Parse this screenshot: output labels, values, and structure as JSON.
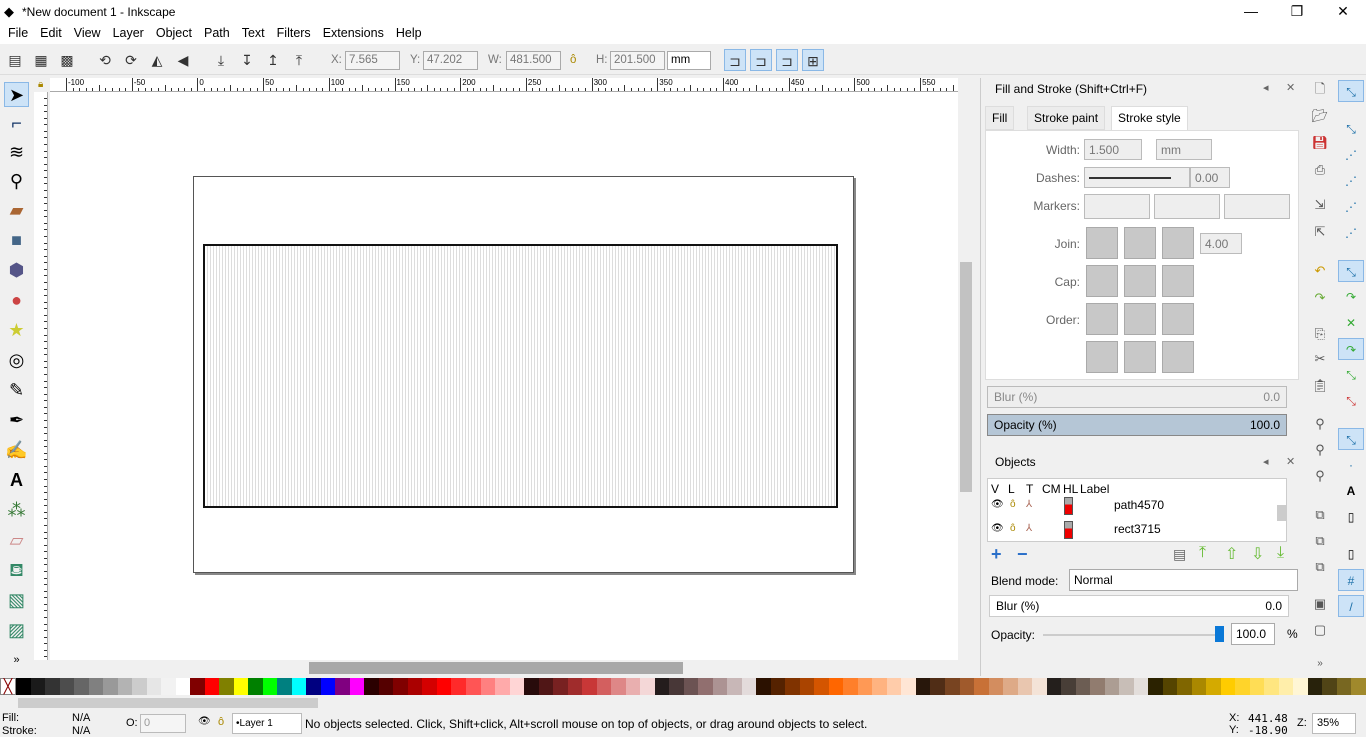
{
  "window": {
    "title": "*New document 1 - Inkscape",
    "minimize": "—",
    "maximize": "❐",
    "close": "✕"
  },
  "menu": [
    "File",
    "Edit",
    "View",
    "Layer",
    "Object",
    "Path",
    "Text",
    "Filters",
    "Extensions",
    "Help"
  ],
  "toolbar": {
    "x_label": "X:",
    "x": "7.565",
    "y_label": "Y:",
    "y": "47.202",
    "w_label": "W:",
    "w": "481.500",
    "h_label": "H:",
    "h": "201.500",
    "unit": "mm"
  },
  "ruler": {
    "h_ticks": [
      "-100",
      "-50",
      "0",
      "50",
      "100",
      "150",
      "200",
      "250",
      "300",
      "350",
      "400",
      "450",
      "500",
      "550"
    ]
  },
  "fill_stroke": {
    "title": "Fill and Stroke (Shift+Ctrl+F)",
    "tabs": [
      "Fill",
      "Stroke paint",
      "Stroke style"
    ],
    "active_tab": "Stroke style",
    "width_label": "Width:",
    "width": "1.500",
    "width_unit": "mm",
    "dashes_label": "Dashes:",
    "dash_offset": "0.00",
    "markers_label": "Markers:",
    "join_label": "Join:",
    "miter": "4.00",
    "cap_label": "Cap:",
    "order_label": "Order:",
    "blur_label": "Blur (%)",
    "blur": "0.0",
    "opacity_label": "Opacity (%)",
    "opacity": "100.0"
  },
  "objects": {
    "title": "Objects",
    "columns": [
      "V",
      "L",
      "T",
      "CM",
      "HL",
      "Label"
    ],
    "rows": [
      {
        "label": "path4570"
      },
      {
        "label": "rect3715"
      }
    ],
    "blend_label": "Blend mode:",
    "blend": "Normal",
    "blur_label": "Blur (%)",
    "blur": "0.0",
    "opacity_label": "Opacity:",
    "opacity": "100.0",
    "opacity_unit": "%",
    "opacity_value": 100
  },
  "status": {
    "fill_label": "Fill:",
    "fill": "N/A",
    "stroke_label": "Stroke:",
    "stroke": "N/A",
    "o_label": "O:",
    "o": "0",
    "layer": "•Layer 1",
    "message": "No objects selected. Click, Shift+click, Alt+scroll mouse on top of objects, or drag around objects to select.",
    "x_label": "X:",
    "cx": "441.48",
    "y_label": "Y:",
    "cy": "-18.90",
    "z_label": "Z:",
    "zoom": "35%"
  },
  "palette": [
    "#000000",
    "#1a1a1a",
    "#333333",
    "#4d4d4d",
    "#666666",
    "#808080",
    "#999999",
    "#b3b3b3",
    "#cccccc",
    "#e6e6e6",
    "#f2f2f2",
    "#ffffff",
    "#800000",
    "#ff0000",
    "#808000",
    "#ffff00",
    "#008000",
    "#00ff00",
    "#008080",
    "#00ffff",
    "#000080",
    "#0000ff",
    "#800080",
    "#ff00ff",
    "#2b0000",
    "#550000",
    "#800000",
    "#aa0000",
    "#d40000",
    "#ff0000",
    "#ff2a2a",
    "#ff5555",
    "#ff8080",
    "#ffaaaa",
    "#ffd5d5",
    "#280b0b",
    "#501616",
    "#782121",
    "#a02c2c",
    "#c83737",
    "#d35f5f",
    "#de8787",
    "#e9afaf",
    "#f4d7d7",
    "#241c1c",
    "#483737",
    "#6c5353",
    "#916f6f",
    "#ac9393",
    "#c8b7b7",
    "#e3dbdb",
    "#2b1100",
    "#552200",
    "#803300",
    "#aa4400",
    "#d45500",
    "#ff6600",
    "#ff7f2a",
    "#ff9955",
    "#ffb380",
    "#ffccaa",
    "#ffe6d5",
    "#28170b",
    "#502d16",
    "#784421",
    "#a05a2c",
    "#c87137",
    "#d38d5f",
    "#deaa87",
    "#e9c6af",
    "#f4e3d7",
    "#241f1c",
    "#483e37",
    "#6c5d53",
    "#917c6f",
    "#ac9d93",
    "#c8beb7",
    "#e3dedb",
    "#2b2200",
    "#554400",
    "#806600",
    "#aa8800",
    "#d4aa00",
    "#ffcc00",
    "#ffd42a",
    "#ffdd55",
    "#ffe680",
    "#ffeeaa",
    "#fff6d5",
    "#28220b",
    "#504416",
    "#786721",
    "#a0892c"
  ]
}
